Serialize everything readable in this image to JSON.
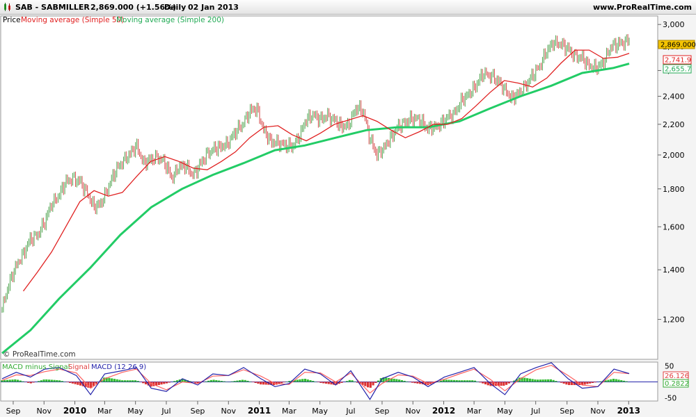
{
  "header": {
    "symbol": "SAB - SABMILLER",
    "quote": "2,869.000 (+1.56%)",
    "interval": "Daily",
    "date": "02 Jan 2013",
    "website": "www.ProRealTime.com"
  },
  "legend": {
    "price": "Price",
    "ma50": "Moving average (Simple 50)",
    "ma200": "Moving average (Simple 200)"
  },
  "watermark": "© ProRealTime.com",
  "macd_legend": {
    "hist": "MACD minus Signal",
    "signal": "Signal",
    "macd": "MACD (12 26 9)"
  },
  "badges": {
    "price": "2,869.000",
    "ma50": "2,741.9",
    "ma200": "2,655.7",
    "macd": "26.126",
    "hist": "0.2822"
  },
  "colors": {
    "price_up": "#3c9a3c",
    "price_down": "#d03030",
    "ma50": "#e02020",
    "ma200": "#22cc66",
    "macd": "#2222aa",
    "signal": "#ff6060",
    "hist_pos": "#33bb33",
    "hist_neg": "#dd3333",
    "badge_price": "#f5c400"
  },
  "chart_data": [
    {
      "type": "candlestick",
      "title": "SAB - SABMILLER",
      "scale": "log",
      "ylim": [
        1060,
        3080
      ],
      "y_ticks": [
        1200,
        1400,
        1600,
        1800,
        2000,
        2200,
        2400,
        2600,
        2800,
        3000
      ],
      "y_tick_labels": [
        "1,200",
        "1,400",
        "1,600",
        "1,800",
        "2,000",
        "2,200",
        "2,400",
        "2,600",
        "2,800",
        "3,000"
      ],
      "x_range": [
        "2009-08-10",
        "2013-01-02"
      ],
      "x_ticks": [
        {
          "label": "Sep",
          "date": "2009-09-01"
        },
        {
          "label": "Nov",
          "date": "2009-11-01"
        },
        {
          "label": "2010",
          "date": "2010-01-01",
          "major": true
        },
        {
          "label": "Mar",
          "date": "2010-03-01"
        },
        {
          "label": "May",
          "date": "2010-05-01"
        },
        {
          "label": "Jul",
          "date": "2010-07-01"
        },
        {
          "label": "Sep",
          "date": "2010-09-01"
        },
        {
          "label": "Nov",
          "date": "2010-11-01"
        },
        {
          "label": "2011",
          "date": "2011-01-01",
          "major": true
        },
        {
          "label": "Mar",
          "date": "2011-03-01"
        },
        {
          "label": "May",
          "date": "2011-05-01"
        },
        {
          "label": "Jul",
          "date": "2011-07-01"
        },
        {
          "label": "Sep",
          "date": "2011-09-01"
        },
        {
          "label": "Nov",
          "date": "2011-11-01"
        },
        {
          "label": "2012",
          "date": "2012-01-01",
          "major": true
        },
        {
          "label": "Mar",
          "date": "2012-03-01"
        },
        {
          "label": "May",
          "date": "2012-05-01"
        },
        {
          "label": "Jul",
          "date": "2012-07-01"
        },
        {
          "label": "Sep",
          "date": "2012-09-01"
        },
        {
          "label": "Nov",
          "date": "2012-11-01"
        },
        {
          "label": "2013",
          "date": "2013-01-01",
          "major": true
        }
      ],
      "price_close": [
        [
          "2009-08-10",
          1240
        ],
        [
          "2009-08-24",
          1340
        ],
        [
          "2009-09-07",
          1420
        ],
        [
          "2009-09-21",
          1470
        ],
        [
          "2009-10-05",
          1540
        ],
        [
          "2009-10-19",
          1560
        ],
        [
          "2009-11-02",
          1620
        ],
        [
          "2009-11-16",
          1720
        ],
        [
          "2009-11-30",
          1760
        ],
        [
          "2009-12-14",
          1840
        ],
        [
          "2009-12-28",
          1860
        ],
        [
          "2010-01-11",
          1840
        ],
        [
          "2010-01-25",
          1780
        ],
        [
          "2010-02-08",
          1700
        ],
        [
          "2010-02-22",
          1720
        ],
        [
          "2010-03-08",
          1810
        ],
        [
          "2010-03-22",
          1900
        ],
        [
          "2010-04-05",
          1960
        ],
        [
          "2010-04-19",
          2000
        ],
        [
          "2010-05-03",
          2060
        ],
        [
          "2010-05-17",
          1950
        ],
        [
          "2010-05-31",
          1970
        ],
        [
          "2010-06-14",
          1990
        ],
        [
          "2010-06-28",
          1950
        ],
        [
          "2010-07-12",
          1860
        ],
        [
          "2010-07-26",
          1930
        ],
        [
          "2010-08-09",
          1930
        ],
        [
          "2010-08-23",
          1880
        ],
        [
          "2010-09-06",
          1940
        ],
        [
          "2010-09-20",
          2010
        ],
        [
          "2010-10-04",
          2040
        ],
        [
          "2010-10-18",
          2050
        ],
        [
          "2010-11-01",
          2080
        ],
        [
          "2010-11-15",
          2150
        ],
        [
          "2010-11-29",
          2200
        ],
        [
          "2010-12-13",
          2290
        ],
        [
          "2010-12-27",
          2310
        ],
        [
          "2011-01-10",
          2160
        ],
        [
          "2011-01-24",
          2080
        ],
        [
          "2011-02-07",
          2080
        ],
        [
          "2011-02-21",
          2060
        ],
        [
          "2011-03-07",
          2050
        ],
        [
          "2011-03-21",
          2120
        ],
        [
          "2011-04-04",
          2230
        ],
        [
          "2011-04-18",
          2270
        ],
        [
          "2011-05-02",
          2230
        ],
        [
          "2011-05-16",
          2260
        ],
        [
          "2011-05-30",
          2230
        ],
        [
          "2011-06-13",
          2180
        ],
        [
          "2011-06-27",
          2200
        ],
        [
          "2011-07-11",
          2310
        ],
        [
          "2011-07-25",
          2300
        ],
        [
          "2011-08-08",
          2100
        ],
        [
          "2011-08-22",
          2000
        ],
        [
          "2011-09-05",
          2050
        ],
        [
          "2011-09-19",
          2110
        ],
        [
          "2011-10-03",
          2190
        ],
        [
          "2011-10-17",
          2210
        ],
        [
          "2011-10-31",
          2240
        ],
        [
          "2011-11-14",
          2240
        ],
        [
          "2011-11-28",
          2170
        ],
        [
          "2011-12-12",
          2180
        ],
        [
          "2011-12-26",
          2200
        ],
        [
          "2012-01-09",
          2250
        ],
        [
          "2012-01-23",
          2280
        ],
        [
          "2012-02-06",
          2370
        ],
        [
          "2012-02-20",
          2420
        ],
        [
          "2012-03-05",
          2480
        ],
        [
          "2012-03-19",
          2580
        ],
        [
          "2012-04-02",
          2560
        ],
        [
          "2012-04-16",
          2520
        ],
        [
          "2012-04-30",
          2460
        ],
        [
          "2012-05-14",
          2380
        ],
        [
          "2012-05-28",
          2420
        ],
        [
          "2012-06-11",
          2480
        ],
        [
          "2012-06-25",
          2560
        ],
        [
          "2012-07-09",
          2640
        ],
        [
          "2012-07-23",
          2760
        ],
        [
          "2012-08-06",
          2840
        ],
        [
          "2012-08-20",
          2820
        ],
        [
          "2012-09-03",
          2780
        ],
        [
          "2012-09-17",
          2720
        ],
        [
          "2012-10-01",
          2700
        ],
        [
          "2012-10-15",
          2640
        ],
        [
          "2012-10-29",
          2620
        ],
        [
          "2012-11-12",
          2660
        ],
        [
          "2012-11-26",
          2800
        ],
        [
          "2012-12-10",
          2820
        ],
        [
          "2012-12-24",
          2840
        ],
        [
          "2013-01-02",
          2869
        ]
      ],
      "ma50": [
        [
          "2009-09-21",
          1310
        ],
        [
          "2009-10-19",
          1390
        ],
        [
          "2009-11-16",
          1480
        ],
        [
          "2009-12-14",
          1600
        ],
        [
          "2010-01-11",
          1730
        ],
        [
          "2010-02-08",
          1790
        ],
        [
          "2010-03-08",
          1760
        ],
        [
          "2010-04-05",
          1780
        ],
        [
          "2010-05-03",
          1870
        ],
        [
          "2010-05-31",
          1960
        ],
        [
          "2010-06-28",
          1990
        ],
        [
          "2010-07-26",
          1960
        ],
        [
          "2010-08-23",
          1920
        ],
        [
          "2010-09-20",
          1910
        ],
        [
          "2010-10-18",
          1960
        ],
        [
          "2010-11-15",
          2020
        ],
        [
          "2010-12-13",
          2110
        ],
        [
          "2011-01-10",
          2180
        ],
        [
          "2011-02-07",
          2190
        ],
        [
          "2011-03-07",
          2130
        ],
        [
          "2011-04-04",
          2090
        ],
        [
          "2011-05-02",
          2140
        ],
        [
          "2011-05-30",
          2200
        ],
        [
          "2011-06-27",
          2230
        ],
        [
          "2011-07-25",
          2260
        ],
        [
          "2011-08-22",
          2220
        ],
        [
          "2011-09-19",
          2160
        ],
        [
          "2011-10-17",
          2110
        ],
        [
          "2011-11-14",
          2150
        ],
        [
          "2011-12-12",
          2200
        ],
        [
          "2012-01-09",
          2200
        ],
        [
          "2012-02-06",
          2240
        ],
        [
          "2012-03-05",
          2330
        ],
        [
          "2012-04-02",
          2430
        ],
        [
          "2012-04-30",
          2520
        ],
        [
          "2012-05-28",
          2500
        ],
        [
          "2012-06-25",
          2470
        ],
        [
          "2012-07-23",
          2540
        ],
        [
          "2012-08-20",
          2660
        ],
        [
          "2012-09-17",
          2770
        ],
        [
          "2012-10-15",
          2770
        ],
        [
          "2012-11-12",
          2700
        ],
        [
          "2012-12-10",
          2710
        ],
        [
          "2013-01-02",
          2742
        ]
      ],
      "ma200": [
        [
          "2009-08-10",
          1080
        ],
        [
          "2009-10-05",
          1160
        ],
        [
          "2009-12-01",
          1280
        ],
        [
          "2010-02-01",
          1410
        ],
        [
          "2010-04-01",
          1560
        ],
        [
          "2010-06-01",
          1700
        ],
        [
          "2010-08-01",
          1800
        ],
        [
          "2010-10-01",
          1880
        ],
        [
          "2010-12-01",
          1950
        ],
        [
          "2011-02-01",
          2030
        ],
        [
          "2011-04-01",
          2060
        ],
        [
          "2011-06-01",
          2110
        ],
        [
          "2011-08-01",
          2160
        ],
        [
          "2011-10-01",
          2180
        ],
        [
          "2011-12-01",
          2180
        ],
        [
          "2012-02-01",
          2220
        ],
        [
          "2012-04-01",
          2310
        ],
        [
          "2012-06-01",
          2400
        ],
        [
          "2012-08-01",
          2480
        ],
        [
          "2012-10-01",
          2580
        ],
        [
          "2012-12-01",
          2620
        ],
        [
          "2013-01-02",
          2656
        ]
      ]
    },
    {
      "type": "macd",
      "title": "MACD (12 26 9)",
      "ylim": [
        -60,
        62
      ],
      "y_ticks": [
        50,
        -50
      ],
      "y_tick_labels": [
        "50",
        "-50"
      ],
      "macd": [
        [
          "2009-08-10",
          10
        ],
        [
          "2009-09-07",
          30
        ],
        [
          "2009-10-05",
          15
        ],
        [
          "2009-11-02",
          40
        ],
        [
          "2009-12-01",
          45
        ],
        [
          "2010-01-04",
          20
        ],
        [
          "2010-02-01",
          -40
        ],
        [
          "2010-03-01",
          25
        ],
        [
          "2010-04-05",
          35
        ],
        [
          "2010-05-03",
          45
        ],
        [
          "2010-06-01",
          -20
        ],
        [
          "2010-07-01",
          -30
        ],
        [
          "2010-08-02",
          10
        ],
        [
          "2010-09-01",
          -10
        ],
        [
          "2010-10-01",
          25
        ],
        [
          "2010-11-01",
          20
        ],
        [
          "2010-12-01",
          45
        ],
        [
          "2011-01-04",
          10
        ],
        [
          "2011-02-01",
          -15
        ],
        [
          "2011-03-01",
          -5
        ],
        [
          "2011-04-01",
          40
        ],
        [
          "2011-05-02",
          25
        ],
        [
          "2011-06-01",
          -10
        ],
        [
          "2011-07-01",
          35
        ],
        [
          "2011-08-08",
          -55
        ],
        [
          "2011-09-01",
          10
        ],
        [
          "2011-10-03",
          30
        ],
        [
          "2011-11-01",
          15
        ],
        [
          "2011-12-01",
          -15
        ],
        [
          "2012-01-02",
          15
        ],
        [
          "2012-02-01",
          30
        ],
        [
          "2012-03-01",
          45
        ],
        [
          "2012-04-02",
          -5
        ],
        [
          "2012-05-01",
          -40
        ],
        [
          "2012-06-01",
          25
        ],
        [
          "2012-07-02",
          45
        ],
        [
          "2012-08-01",
          60
        ],
        [
          "2012-09-03",
          10
        ],
        [
          "2012-10-01",
          -20
        ],
        [
          "2012-11-01",
          -15
        ],
        [
          "2012-12-03",
          40
        ],
        [
          "2013-01-02",
          26
        ]
      ],
      "signal": [
        [
          "2009-08-10",
          5
        ],
        [
          "2009-09-07",
          22
        ],
        [
          "2009-10-05",
          20
        ],
        [
          "2009-11-02",
          32
        ],
        [
          "2009-12-01",
          40
        ],
        [
          "2010-01-04",
          28
        ],
        [
          "2010-02-01",
          -20
        ],
        [
          "2010-03-01",
          10
        ],
        [
          "2010-04-05",
          30
        ],
        [
          "2010-05-03",
          40
        ],
        [
          "2010-06-01",
          -5
        ],
        [
          "2010-07-01",
          -25
        ],
        [
          "2010-08-02",
          0
        ],
        [
          "2010-09-01",
          -5
        ],
        [
          "2010-10-01",
          18
        ],
        [
          "2010-11-01",
          20
        ],
        [
          "2010-12-01",
          38
        ],
        [
          "2011-01-04",
          18
        ],
        [
          "2011-02-01",
          -5
        ],
        [
          "2011-03-01",
          -8
        ],
        [
          "2011-04-01",
          30
        ],
        [
          "2011-05-02",
          28
        ],
        [
          "2011-06-01",
          0
        ],
        [
          "2011-07-01",
          28
        ],
        [
          "2011-08-08",
          -35
        ],
        [
          "2011-09-01",
          -5
        ],
        [
          "2011-10-03",
          22
        ],
        [
          "2011-11-01",
          18
        ],
        [
          "2011-12-01",
          -5
        ],
        [
          "2012-01-02",
          8
        ],
        [
          "2012-02-01",
          25
        ],
        [
          "2012-03-01",
          40
        ],
        [
          "2012-04-02",
          8
        ],
        [
          "2012-05-01",
          -28
        ],
        [
          "2012-06-01",
          10
        ],
        [
          "2012-07-02",
          38
        ],
        [
          "2012-08-01",
          52
        ],
        [
          "2012-09-03",
          20
        ],
        [
          "2012-10-01",
          -10
        ],
        [
          "2012-11-01",
          -15
        ],
        [
          "2012-12-03",
          30
        ],
        [
          "2013-01-02",
          25.8
        ]
      ]
    }
  ]
}
